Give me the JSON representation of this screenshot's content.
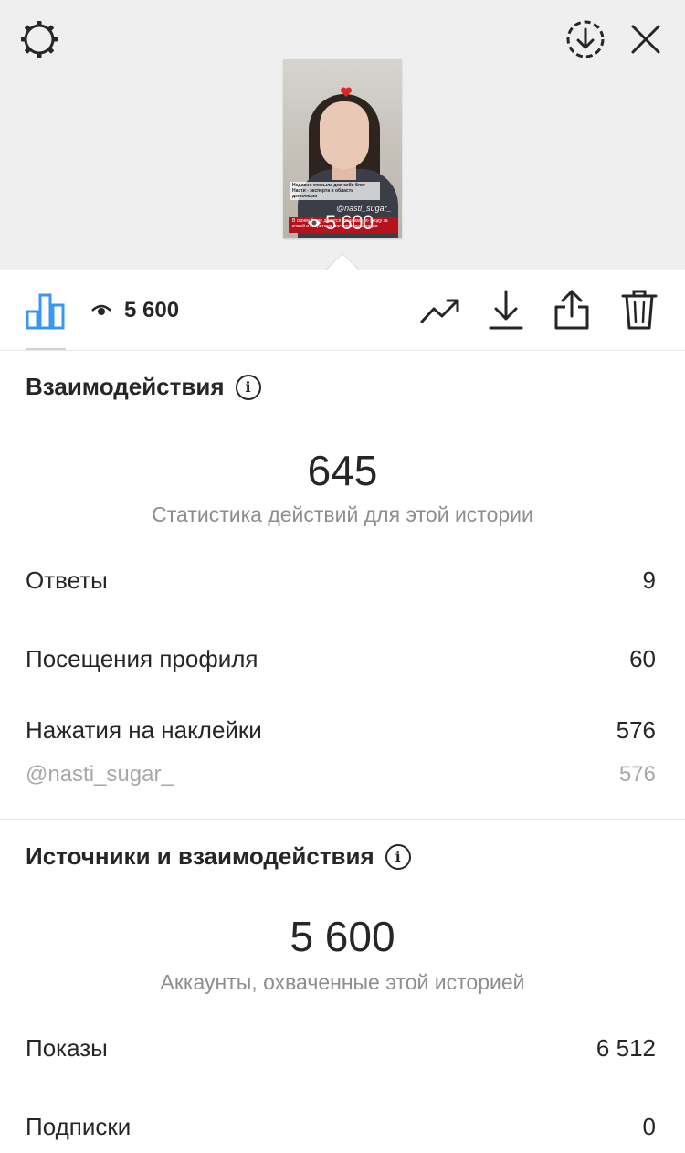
{
  "top_bar": {
    "settings_icon": "gear-icon",
    "save_icon": "download-circle-icon",
    "close_icon": "close-icon"
  },
  "story_preview": {
    "caption": "Недавно открыла для себя блог Насти - эксперта в области депиляции",
    "handle": "@nasti_sugar_",
    "band_text": "В своем блоге делится фишками по уходу за кожей и секретами мастеров депиляции",
    "views": "5 600"
  },
  "toolbar": {
    "views_count": "5 600",
    "icons": [
      "bar-chart-icon",
      "eye-icon",
      "trending-icon",
      "download-icon",
      "share-icon",
      "trash-icon"
    ]
  },
  "interactions": {
    "title": "Взаимодействия",
    "total": "645",
    "caption": "Статистика действий для этой истории",
    "rows": [
      {
        "label": "Ответы",
        "value": "9"
      },
      {
        "label": "Посещения профиля",
        "value": "60"
      },
      {
        "label": "Нажатия на наклейки",
        "value": "576"
      }
    ],
    "sticker_row": {
      "label": "@nasti_sugar_",
      "value": "576"
    }
  },
  "discovery": {
    "title": "Источники и взаимодействия",
    "total": "5 600",
    "caption": "Аккаунты, охваченные этой историей",
    "rows": [
      {
        "label": "Показы",
        "value": "6 512"
      },
      {
        "label": "Подписки",
        "value": "0"
      }
    ]
  },
  "colors": {
    "accent": "#3897f0",
    "text": "#262626",
    "secondary": "#8e8e8e",
    "story_band": "#b5121b"
  }
}
